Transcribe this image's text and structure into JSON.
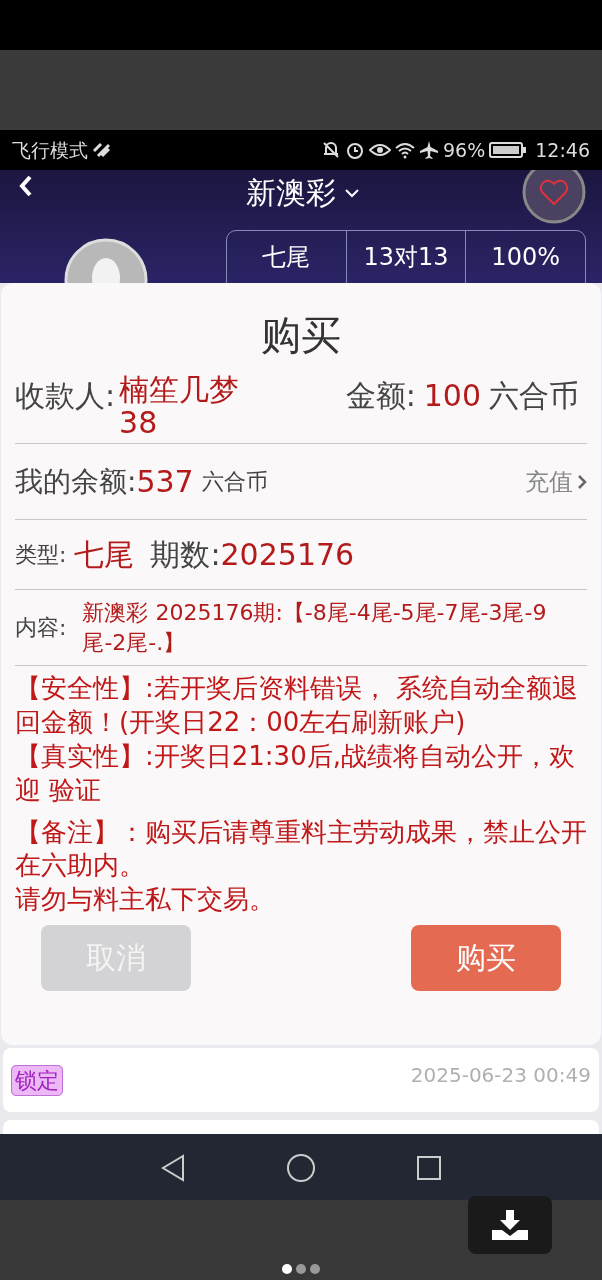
{
  "status_bar": {
    "mode": "飞行模式",
    "battery": "96%",
    "time": "12:46"
  },
  "header": {
    "title": "新澳彩"
  },
  "stats": [
    {
      "value": "七尾"
    },
    {
      "value": "13对13"
    },
    {
      "value": "100%"
    }
  ],
  "dialog": {
    "title": "购买",
    "payee_label": "收款人:",
    "payee": "楠笙几梦38",
    "amount_label": "金额:",
    "amount": "100",
    "amount_unit": "六合币",
    "balance_label": "我的余额:",
    "balance": "537",
    "balance_unit": "六合币",
    "recharge": "充值",
    "type_label": "类型:",
    "type": "七尾",
    "period_label": "期数:",
    "period": "2025176",
    "content_label": "内容:",
    "content": "新澳彩 2025176期:【-8尾-4尾-5尾-7尾-3尾-9尾-2尾-.】",
    "notes": [
      "【安全性】:若开奖后资料错误， 系统自动全额退回金额！(开奖日22：00左右刷新账户)",
      "【真实性】:开奖日21:30后,战绩将自动公开，欢迎 验证",
      "【备注】：购买后请尊重料主劳动成果，禁止公开在六助内。",
      "请勿与料主私下交易。"
    ],
    "buttons": [
      {
        "label": "取消",
        "kind": "cancel"
      },
      {
        "label": "购买",
        "kind": "confirm"
      }
    ]
  },
  "list_item": {
    "tag": "锁定",
    "time": "2025-06-23 00:49"
  },
  "viewer": {
    "pages": [
      {
        "selected": true
      },
      {
        "selected": false
      },
      {
        "selected": false
      }
    ]
  }
}
